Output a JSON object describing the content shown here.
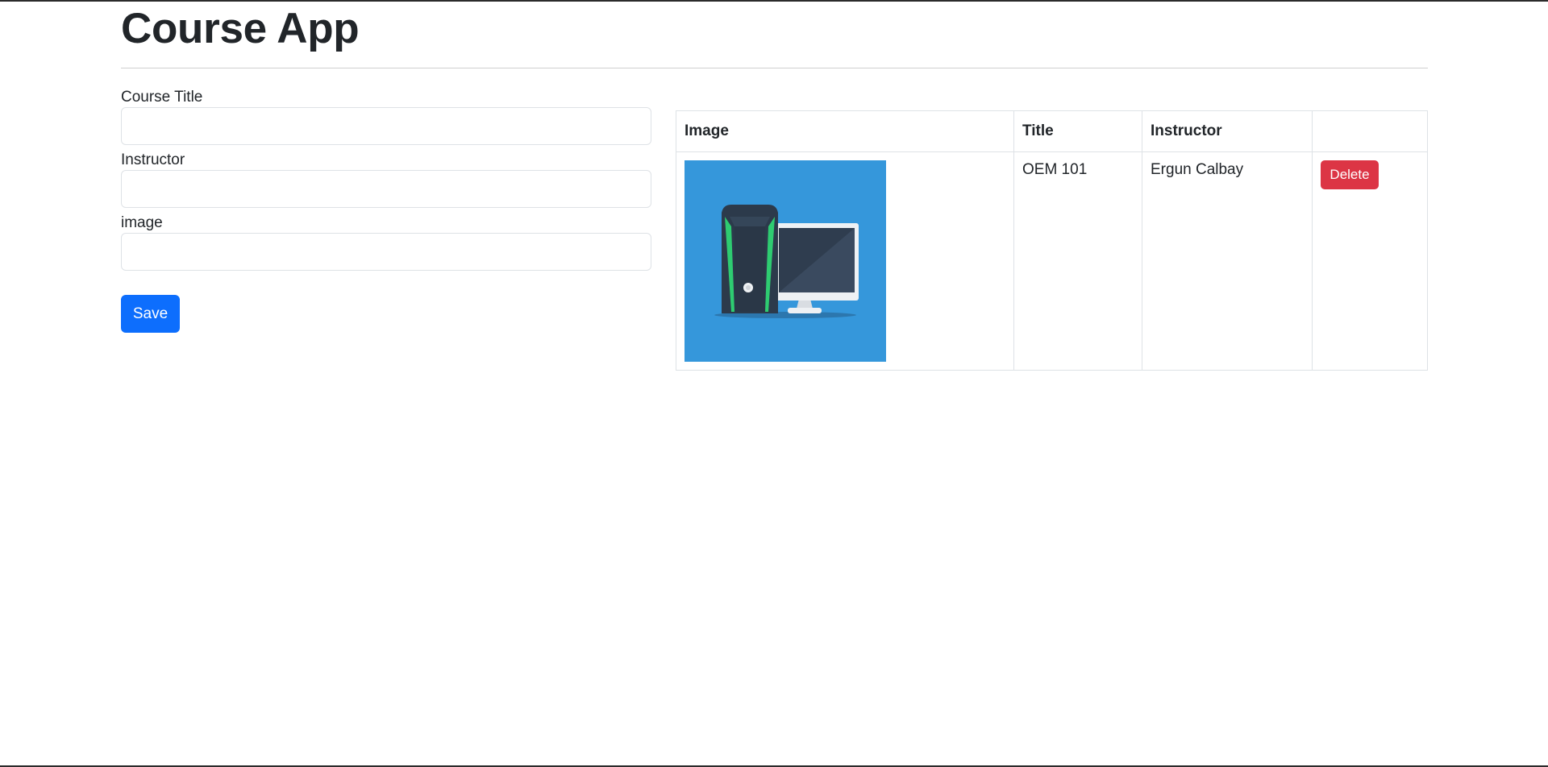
{
  "app": {
    "title": "Course App"
  },
  "form": {
    "fields": [
      {
        "label": "Course Title",
        "value": "",
        "placeholder": ""
      },
      {
        "label": "Instructor",
        "value": "",
        "placeholder": ""
      },
      {
        "label": "image",
        "value": "",
        "placeholder": ""
      }
    ],
    "save_label": "Save"
  },
  "table": {
    "headers": [
      "Image",
      "Title",
      "Instructor",
      ""
    ],
    "rows": [
      {
        "image_icon": "desktop-computer-icon",
        "title": "OEM 101",
        "instructor": "Ergun Calbay",
        "delete_label": "Delete"
      }
    ]
  },
  "colors": {
    "primary": "#0d6efd",
    "danger": "#dc3545",
    "text": "#212529",
    "border": "#dee2e6",
    "image_bg": "#3597db"
  }
}
